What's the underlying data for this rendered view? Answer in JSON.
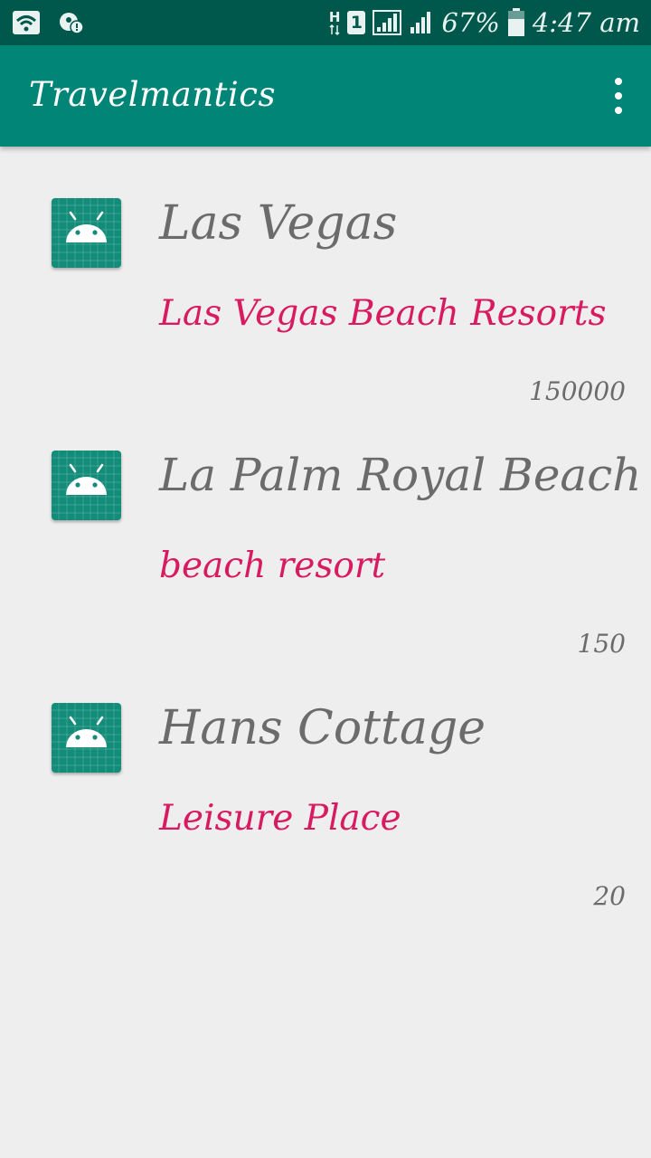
{
  "status_bar": {
    "network_label": "H",
    "sim_label": "1",
    "battery": "67%",
    "time": "4:47 am",
    "icons": [
      "wifi-icon",
      "notification-icon",
      "data-arrows-icon",
      "signal-icon",
      "battery-icon"
    ]
  },
  "app_bar": {
    "title": "Travelmantics",
    "menu_icon": "overflow-menu-icon"
  },
  "deals": [
    {
      "title": "Las Vegas",
      "description": "Las Vegas Beach Resorts",
      "price": "150000",
      "icon": "android-icon"
    },
    {
      "title": "La Palm Royal Beach",
      "description": "beach resort",
      "price": "150",
      "icon": "android-icon"
    },
    {
      "title": "Hans Cottage",
      "description": "Leisure Place",
      "price": "20",
      "icon": "android-icon"
    }
  ],
  "colors": {
    "status_bar": "#00574b",
    "app_bar": "#008577",
    "background": "#eeeeee",
    "title_text": "#6b6b6b",
    "description_text": "#d81b60",
    "icon_bg": "#138c79"
  }
}
